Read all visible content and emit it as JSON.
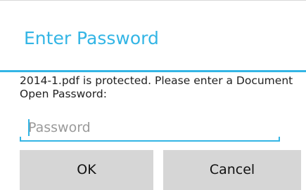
{
  "dialog": {
    "title": "Enter Password",
    "message": "2014-1.pdf is protected. Please enter a Document Open Password:",
    "password_input": {
      "value": "",
      "placeholder": "Password"
    },
    "buttons": {
      "ok_label": "OK",
      "cancel_label": "Cancel"
    }
  },
  "colors": {
    "accent": "#33b5e5",
    "button_bg": "#d6d6d6",
    "text": "#222222",
    "placeholder": "#9a9a9a"
  }
}
